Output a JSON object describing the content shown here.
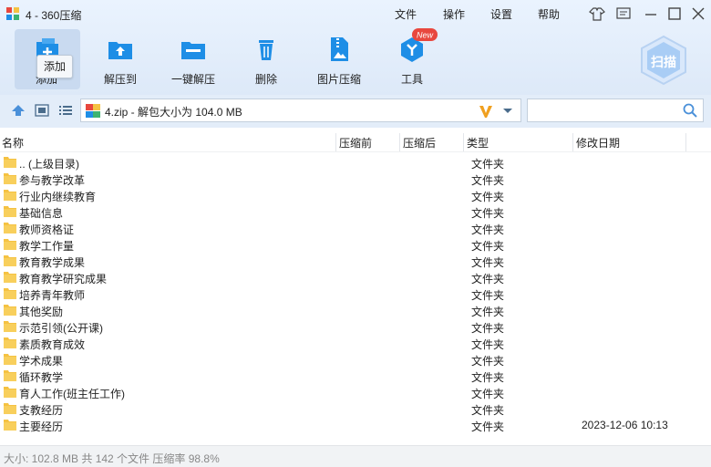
{
  "window": {
    "title": "4 - 360压缩",
    "menus": [
      "文件",
      "操作",
      "设置",
      "帮助"
    ]
  },
  "toolbar": {
    "buttons": [
      {
        "label": "添加",
        "icon": "add-icon"
      },
      {
        "label": "解压到",
        "icon": "extract-to-icon"
      },
      {
        "label": "一键解压",
        "icon": "one-click-extract-icon"
      },
      {
        "label": "删除",
        "icon": "delete-icon"
      },
      {
        "label": "图片压缩",
        "icon": "image-compress-icon"
      },
      {
        "label": "工具",
        "icon": "tools-icon"
      }
    ],
    "tools_badge": "New",
    "scan_label": "扫描",
    "tooltip": "添加"
  },
  "address": {
    "path": "4.zip - 解包大小为 104.0 MB"
  },
  "columns": {
    "name": "名称",
    "compressed": "压缩前",
    "uncompressed": "压缩后",
    "type": "类型",
    "modified": "修改日期"
  },
  "rows": [
    {
      "name": ".. (上级目录)",
      "type": "文件夹",
      "date": ""
    },
    {
      "name": "参与教学改革",
      "type": "文件夹",
      "date": ""
    },
    {
      "name": "行业内继续教育",
      "type": "文件夹",
      "date": ""
    },
    {
      "name": "基础信息",
      "type": "文件夹",
      "date": ""
    },
    {
      "name": "教师资格证",
      "type": "文件夹",
      "date": ""
    },
    {
      "name": "教学工作量",
      "type": "文件夹",
      "date": ""
    },
    {
      "name": "教育教学成果",
      "type": "文件夹",
      "date": ""
    },
    {
      "name": "教育教学研究成果",
      "type": "文件夹",
      "date": ""
    },
    {
      "name": "培养青年教师",
      "type": "文件夹",
      "date": ""
    },
    {
      "name": "其他奖励",
      "type": "文件夹",
      "date": ""
    },
    {
      "name": "示范引领(公开课)",
      "type": "文件夹",
      "date": ""
    },
    {
      "name": "素质教育成效",
      "type": "文件夹",
      "date": ""
    },
    {
      "name": "学术成果",
      "type": "文件夹",
      "date": ""
    },
    {
      "name": "循环教学",
      "type": "文件夹",
      "date": ""
    },
    {
      "name": "育人工作(班主任工作)",
      "type": "文件夹",
      "date": ""
    },
    {
      "name": "支教经历",
      "type": "文件夹",
      "date": ""
    },
    {
      "name": "主要经历",
      "type": "文件夹",
      "date": "2023-12-06 10:13"
    }
  ],
  "status": {
    "text": "大小: 102.8 MB 共 142 个文件 压缩率 98.8%"
  },
  "colors": {
    "accent": "#1e8ee6",
    "folder": "#f5c242",
    "badge": "#e8473e"
  }
}
